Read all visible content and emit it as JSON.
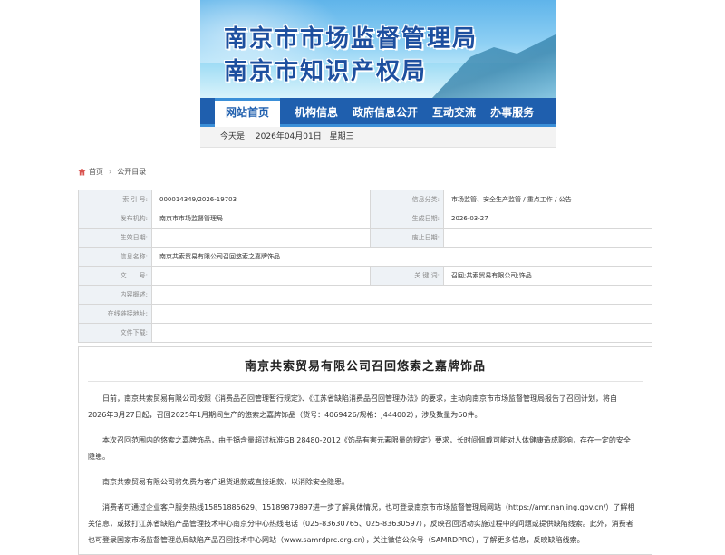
{
  "header": {
    "title_line1": "南京市市场监督管理局",
    "title_line2": "南京市知识产权局"
  },
  "nav": {
    "items": [
      "网站首页",
      "机构信息",
      "政府信息公开",
      "互动交流",
      "办事服务"
    ]
  },
  "datebar": {
    "label": "今天是:",
    "date": "2026年04月01日",
    "weekday": "星期三"
  },
  "breadcrumb": {
    "home": "首页",
    "current": "公开目录"
  },
  "meta": {
    "rows": [
      {
        "k1": "索 引 号:",
        "v1": "000014349/2026-19703",
        "k2": "信息分类:",
        "v2": "市场监管、安全生产监管 / 重点工作 / 公告"
      },
      {
        "k1": "发布机构:",
        "v1": "南京市市场监督管理局",
        "k2": "生成日期:",
        "v2": "2026-03-27"
      },
      {
        "k1": "生效日期:",
        "v1": "",
        "k2": "废止日期:",
        "v2": ""
      },
      {
        "k1": "信息名称:",
        "full": "南京共索贸易有限公司召回悠索之嘉牌饰品"
      },
      {
        "k1": "文　　号:",
        "v1": "",
        "k2": "关 键 词:",
        "v2": "召回;共索贸易有限公司;饰品"
      },
      {
        "k1": "内容概述:",
        "full": ""
      },
      {
        "k1": "在线链接地址:",
        "full": ""
      },
      {
        "k1": "文件下载:",
        "full": ""
      }
    ]
  },
  "article": {
    "title": "南京共索贸易有限公司召回悠索之嘉牌饰品",
    "paragraphs": [
      "日前，南京共索贸易有限公司按照《消费品召回管理暂行规定》、《江苏省缺陷消费品召回管理办法》的要求，主动向南京市市场监督管理局报告了召回计划，将自2026年3月27日起，召回2025年1月期间生产的悠索之嘉牌饰品（货号：4069426/规格：J444002），涉及数量为60件。",
      "本次召回范围内的悠索之嘉牌饰品，由于镉含量超过标准GB 28480-2012《饰品有害元素限量的规定》要求，长时间佩戴可能对人体健康造成影响，存在一定的安全隐患。",
      "南京共索贸易有限公司将免费为客户退货退款或直接退款，以消除安全隐患。",
      "消费者可通过企业客户服务热线15851885629、15189879897进一步了解具体情况，也可登录南京市市场监督管理局网站（https://amr.nanjing.gov.cn/）了解相关信息，或拨打江苏省缺陷产品管理技术中心南京分中心热线电话（025-83630765、025-83630597），反映召回活动实施过程中的问题或提供缺陷线索。此外，消费者也可登录国家市场监督管理总局缺陷产品召回技术中心网站（www.samrdprc.org.cn），关注微信公众号（SAMRDPRC），了解更多信息，反映缺陷线索。"
    ]
  }
}
